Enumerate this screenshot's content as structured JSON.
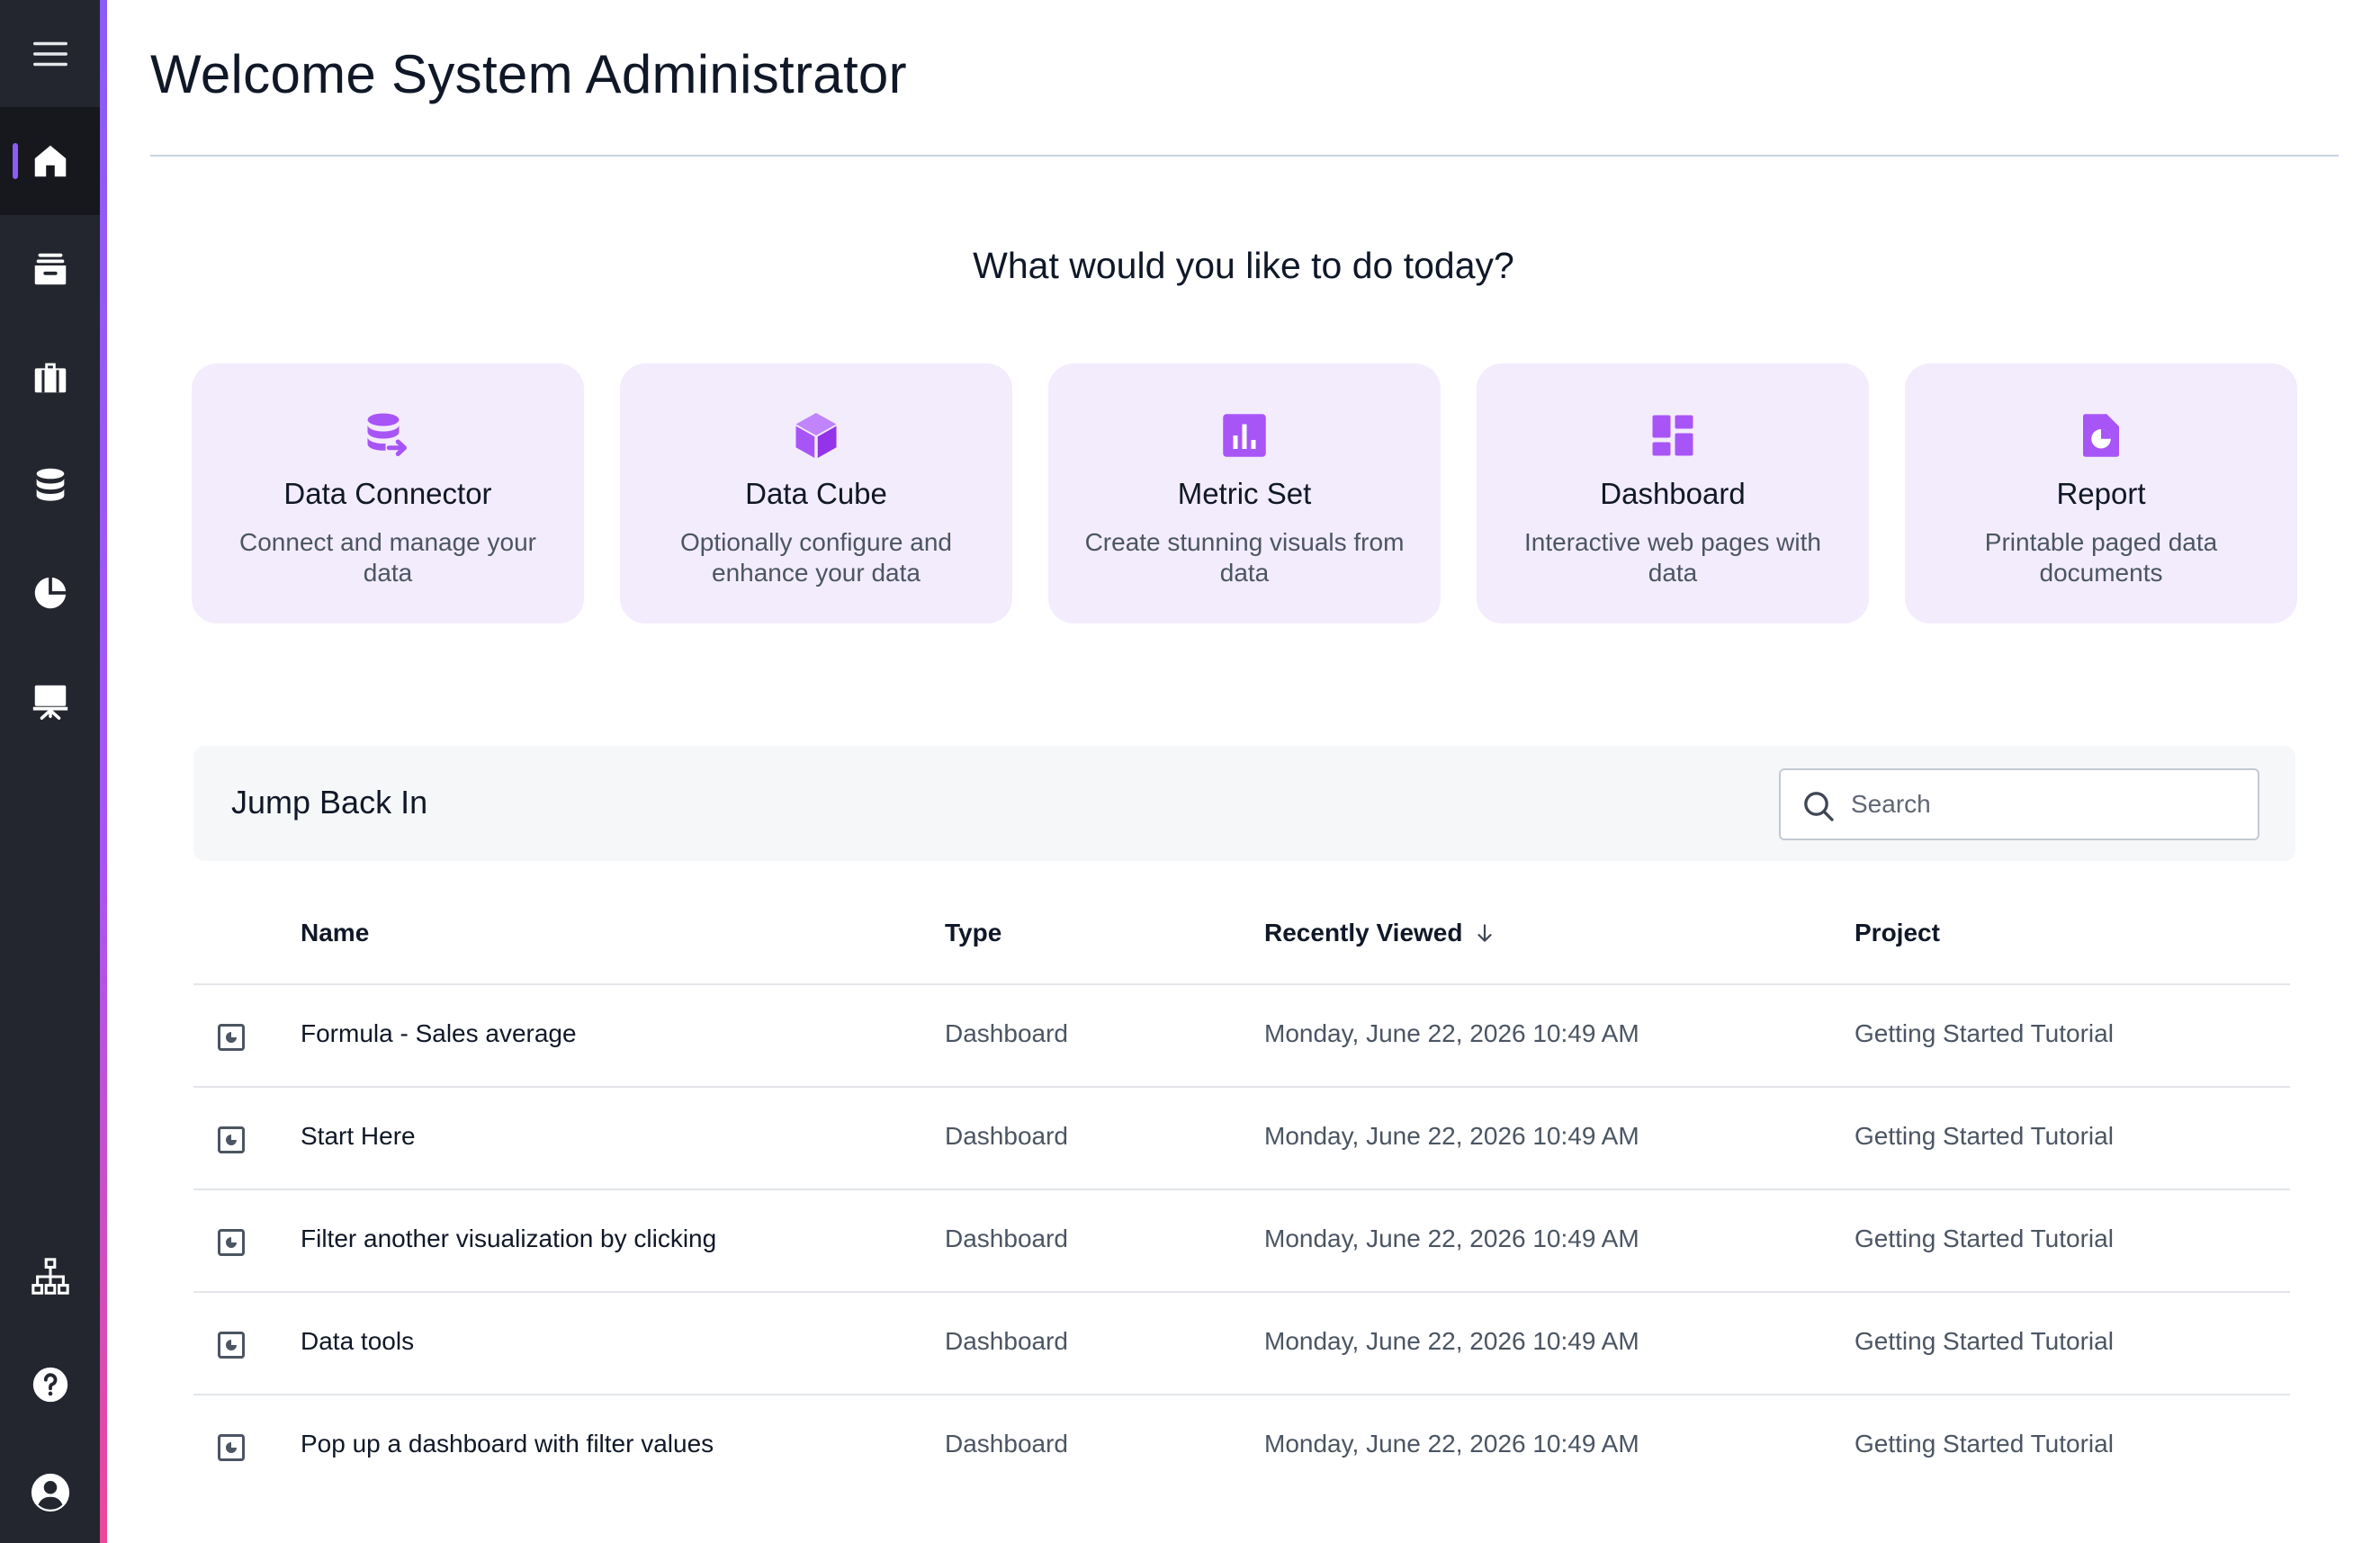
{
  "colors": {
    "sidebar_bg": "#23262f",
    "accent": "#8b5cf6",
    "card_bg": "#f3ecfd",
    "icon_purple": "#a855f7"
  },
  "sidebar": {
    "menu_icon": "hamburger-menu-icon",
    "items": [
      {
        "id": "home",
        "icon": "home-icon",
        "active": true
      },
      {
        "id": "inbox",
        "icon": "inbox-icon",
        "active": false
      },
      {
        "id": "projects",
        "icon": "briefcase-icon",
        "active": false
      },
      {
        "id": "data",
        "icon": "database-icon",
        "active": false
      },
      {
        "id": "analytics",
        "icon": "pie-chart-icon",
        "active": false
      },
      {
        "id": "presentation",
        "icon": "presentation-icon",
        "active": false
      }
    ],
    "bottom_items": [
      {
        "id": "hierarchy",
        "icon": "sitemap-icon"
      },
      {
        "id": "help",
        "icon": "help-icon"
      },
      {
        "id": "account",
        "icon": "user-account-icon"
      }
    ]
  },
  "header": {
    "title": "Welcome System Administrator"
  },
  "prompt": "What would you like to do today?",
  "cards": [
    {
      "title": "Data Connector",
      "description": "Connect and manage your data",
      "icon": "database-connector-icon"
    },
    {
      "title": "Data Cube",
      "description": "Optionally configure and enhance your data",
      "icon": "cube-icon"
    },
    {
      "title": "Metric Set",
      "description": "Create stunning visuals from data",
      "icon": "bar-chart-icon"
    },
    {
      "title": "Dashboard",
      "description": "Interactive web pages with data",
      "icon": "dashboard-grid-icon"
    },
    {
      "title": "Report",
      "description": "Printable paged data documents",
      "icon": "report-document-icon"
    }
  ],
  "jump_back_in": {
    "title": "Jump Back In",
    "search_placeholder": "Search",
    "columns": {
      "name": "Name",
      "type": "Type",
      "recently_viewed": "Recently Viewed",
      "project": "Project"
    },
    "sort": {
      "column": "recently_viewed",
      "direction": "descending"
    },
    "rows": [
      {
        "name": "Formula - Sales average",
        "type": "Dashboard",
        "recently_viewed": "Monday, June 22, 2026 10:49 AM",
        "project": "Getting Started Tutorial"
      },
      {
        "name": "Start Here",
        "type": "Dashboard",
        "recently_viewed": "Monday, June 22, 2026 10:49 AM",
        "project": "Getting Started Tutorial"
      },
      {
        "name": "Filter another visualization by clicking",
        "type": "Dashboard",
        "recently_viewed": "Monday, June 22, 2026 10:49 AM",
        "project": "Getting Started Tutorial"
      },
      {
        "name": "Data tools",
        "type": "Dashboard",
        "recently_viewed": "Monday, June 22, 2026 10:49 AM",
        "project": "Getting Started Tutorial"
      },
      {
        "name": "Pop up a dashboard with filter values",
        "type": "Dashboard",
        "recently_viewed": "Monday, June 22, 2026 10:49 AM",
        "project": "Getting Started Tutorial"
      }
    ]
  }
}
